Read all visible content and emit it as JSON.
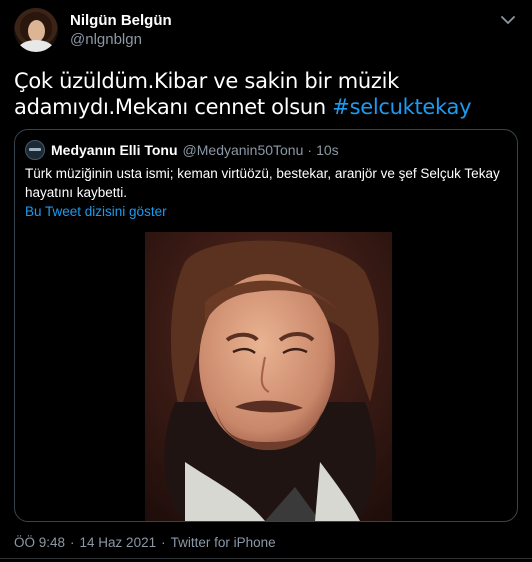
{
  "author": {
    "display_name": "Nilgün Belgün",
    "handle": "@nlgnblgn"
  },
  "tweet": {
    "text": "Çok üzüldüm.Kibar ve sakin bir müzik adamıydı.Mekanı cennet olsun ",
    "hashtag": "#selcuktekay"
  },
  "quoted": {
    "display_name": "Medyanın Elli Tonu",
    "handle": "@Medyanin50Tonu",
    "separator": "·",
    "time": "10s",
    "text": "Türk müziğinin usta ismi; keman virtüözü, bestekar, aranjör ve şef Selçuk Tekay hayatını kaybetti.",
    "thread_link": "Bu Tweet dizisini göster"
  },
  "meta": {
    "time": "ÖÖ 9:48",
    "separator1": "·",
    "date": "14 Haz 2021",
    "separator2": "·",
    "source": "Twitter for iPhone"
  },
  "icons": {
    "more": "chevron-down-icon"
  },
  "colors": {
    "background": "#000000",
    "link": "#1d9bf0",
    "secondary_text": "#8b98a5",
    "border": "#38444d"
  }
}
